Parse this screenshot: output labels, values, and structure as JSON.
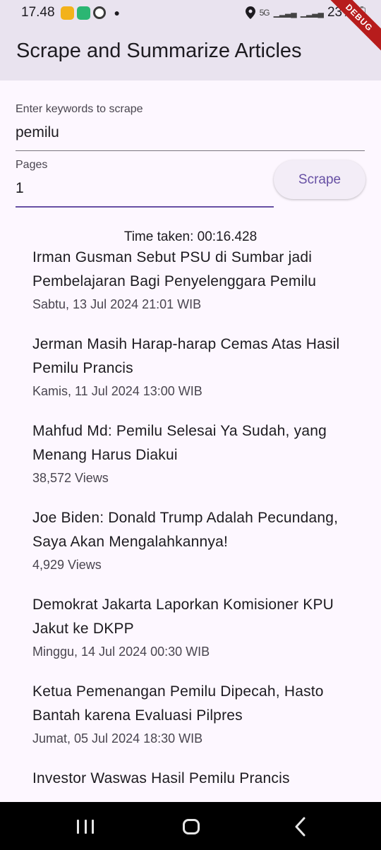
{
  "status_bar": {
    "time": "17.48",
    "battery": "23%",
    "network": "5G"
  },
  "appbar": {
    "title": "Scrape and Summarize Articles",
    "debug_label": "DEBUG"
  },
  "form": {
    "keywords_label": "Enter keywords to scrape",
    "keywords_value": "pemilu",
    "pages_label": "Pages",
    "pages_value": "1",
    "scrape_button": "Scrape"
  },
  "time_taken": "Time taken: 00:16.428",
  "articles": [
    {
      "title": "Irman Gusman Sebut PSU di Sumbar jadi Pembelajaran Bagi Penyelenggara Pemilu",
      "meta": "Sabtu, 13 Jul 2024 21:01 WIB"
    },
    {
      "title": "Jerman Masih Harap-harap Cemas Atas Hasil Pemilu Prancis",
      "meta": "Kamis, 11 Jul 2024 13:00 WIB"
    },
    {
      "title": "Mahfud Md: Pemilu Selesai Ya Sudah, yang Menang Harus Diakui",
      "meta": "38,572 Views"
    },
    {
      "title": "Joe Biden: Donald Trump Adalah Pecundang, Saya Akan Mengalahkannya!",
      "meta": "4,929 Views"
    },
    {
      "title": "Demokrat Jakarta Laporkan Komisioner KPU Jakut ke DKPP",
      "meta": "Minggu, 14 Jul 2024 00:30 WIB"
    },
    {
      "title": "Ketua Pemenangan Pemilu Dipecah, Hasto Bantah karena Evaluasi Pilpres",
      "meta": "Jumat, 05 Jul 2024 18:30 WIB"
    },
    {
      "title": "Investor Waswas Hasil Pemilu Prancis",
      "meta": ""
    }
  ]
}
